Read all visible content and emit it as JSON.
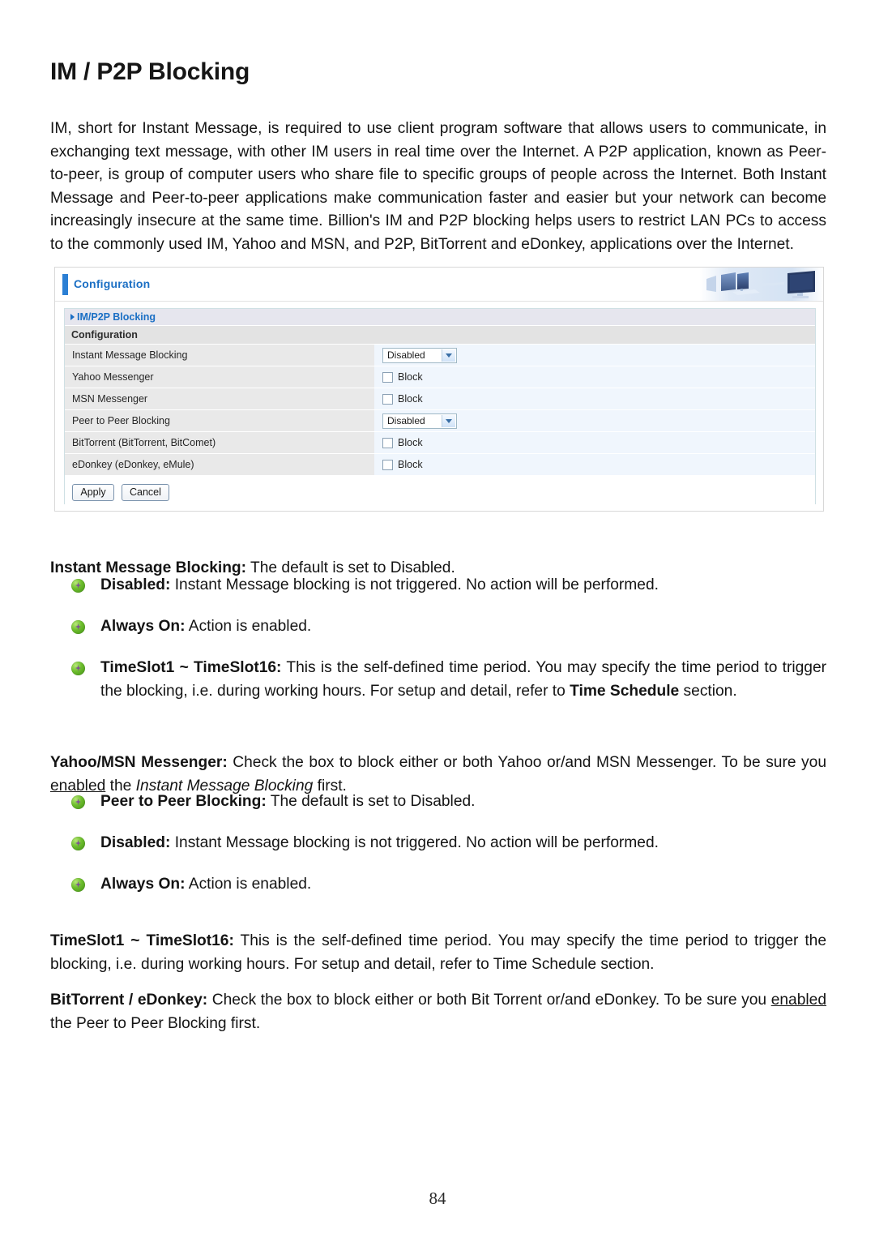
{
  "document": {
    "title": "IM / P2P Blocking",
    "page_number": "84",
    "intro": "IM, short for Instant Message, is required to use client program software that allows users to communicate, in exchanging text message, with other IM users in real time over the Internet. A P2P application, known as Peer-to-peer, is group of computer users who share file to specific groups of people across the Internet. Both Instant Message and Peer-to-peer applications make communication faster and easier but your network can become increasingly insecure at the same time. Billion's IM and P2P blocking helps users to restrict LAN PCs to access to the commonly used IM, Yahoo and MSN, and P2P, BitTorrent and eDonkey, applications over the Internet."
  },
  "screenshot": {
    "header_label": "Configuration",
    "banner_icon": "workstation-banner-image",
    "section_title": "IM/P2P Blocking",
    "subsection_title": "Configuration",
    "rows": [
      {
        "label": "Instant Message Blocking",
        "control": "select",
        "value": "Disabled"
      },
      {
        "label": "Yahoo Messenger",
        "control": "checkbox",
        "value": "Block",
        "checked": false
      },
      {
        "label": "MSN Messenger",
        "control": "checkbox",
        "value": "Block",
        "checked": false
      },
      {
        "label": "Peer to Peer Blocking",
        "control": "select",
        "value": "Disabled"
      },
      {
        "label": "BitTorrent (BitTorrent, BitComet)",
        "control": "checkbox",
        "value": "Block",
        "checked": false
      },
      {
        "label": "eDonkey (eDonkey, eMule)",
        "control": "checkbox",
        "value": "Block",
        "checked": false
      }
    ],
    "buttons": {
      "apply": "Apply",
      "cancel": "Cancel"
    },
    "colors": {
      "accent_blue": "#1b6fc4",
      "label_cell": "#e9e9e9",
      "value_cell": "#f0f6fd",
      "section_band": "#e6e6ee",
      "subsection_band": "#e3e3e3"
    }
  },
  "descriptions": {
    "im_blocking_heading_bold": "Instant Message Blocking:",
    "im_blocking_heading_rest": " The default is set to Disabled.",
    "im_disabled_bold": "Disabled:",
    "im_disabled_rest": " Instant Message blocking is not triggered. No action will be performed.",
    "im_always_on_bold": "Always On:",
    "im_always_on_rest": " Action is enabled.",
    "im_timeslot_bold": "TimeSlot1 ~ TimeSlot16:",
    "im_timeslot_rest_a": "  This is the self-defined time period.  You may specify the time period to trigger the blocking, i.e. during working hours. For setup and detail, refer to ",
    "im_timeslot_bold_b": "Time Schedule",
    "im_timeslot_rest_b": " section.",
    "yahoo_msn_bold": "Yahoo/MSN Messenger:",
    "yahoo_msn_rest_a": " Check the box to block either or both Yahoo or/and MSN Messenger.  To be sure you ",
    "yahoo_msn_underline": "enabled",
    "yahoo_msn_rest_b": " the ",
    "yahoo_msn_italic": "Instant Message Blocking",
    "yahoo_msn_rest_c": " first.",
    "p2p_heading_bold": "Peer to Peer Blocking:",
    "p2p_heading_rest": " The default is set to Disabled.",
    "p2p_disabled_bold": "Disabled:",
    "p2p_disabled_rest": " Instant Message blocking is not triggered. No action will be performed.",
    "p2p_always_on_bold": "Always On:",
    "p2p_always_on_rest": " Action is enabled.",
    "p2p_timeslot_bold": "TimeSlot1 ~ TimeSlot16:",
    "p2p_timeslot_rest": "  This is the self-defined time period.  You may specify the time period to trigger the blocking, i.e. during working hours. For setup and detail, refer to Time Schedule section.",
    "bt_edonkey_bold": "BitTorrent / eDonkey:",
    "bt_edonkey_rest_a": " Check the box to block either or both Bit Torrent or/and eDonkey.  To be sure you ",
    "bt_edonkey_underline": "enabled",
    "bt_edonkey_rest_b": " the Peer to Peer Blocking first."
  }
}
